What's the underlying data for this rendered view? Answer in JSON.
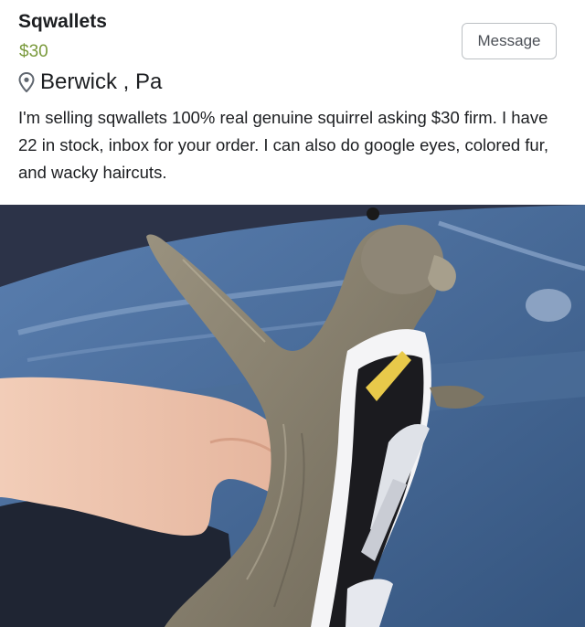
{
  "listing": {
    "title": "Sqwallets",
    "price": "$30",
    "location": "Berwick , Pa",
    "description": "I'm selling sqwallets 100% real genuine squirrel asking $30 firm. I have 22 in stock, inbox for your order. I can also do google eyes, colored fur, and wacky haircuts.",
    "message_label": "Message"
  },
  "icons": {
    "location": "map-pin-icon"
  },
  "colors": {
    "price": "#7a9a3c",
    "jeans": "#4a6f9e",
    "fur": "#8a8272"
  }
}
